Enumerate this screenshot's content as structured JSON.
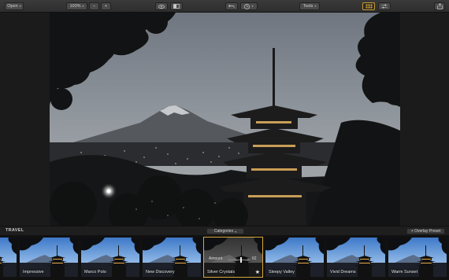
{
  "toolbar": {
    "open_label": "Open",
    "zoom_label": "100%",
    "minus_label": "−",
    "plus_label": "+",
    "tools_label": "Tools"
  },
  "preset_bar": {
    "category_title": "TRAVEL",
    "categories_label": "Categories",
    "overlay_label": "+ Overlay Preset"
  },
  "filmstrip": {
    "presets": [
      {
        "label": ""
      },
      {
        "label": "Impressive"
      },
      {
        "label": "Marco Polo"
      },
      {
        "label": "New Discovery"
      },
      {
        "label": "Silver Crystals",
        "selected": true
      },
      {
        "label": "Sleepy Valley"
      },
      {
        "label": "Vivid Dreams"
      },
      {
        "label": "Warm Sunset"
      },
      {
        "label": ""
      }
    ],
    "amount_label": "Amount",
    "amount_value": "62",
    "amount_level": 0.62
  },
  "colors": {
    "accent": "#d7a63a"
  }
}
